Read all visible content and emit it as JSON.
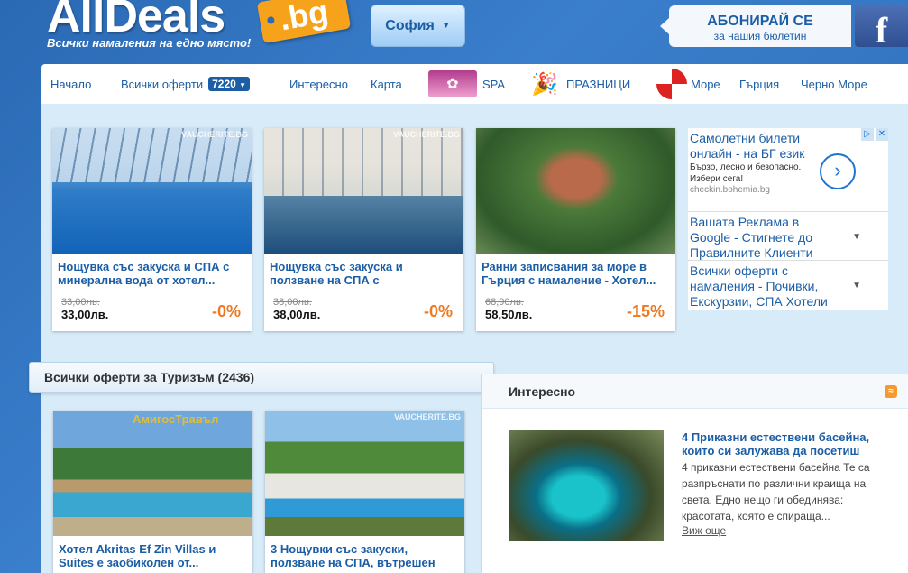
{
  "header": {
    "logo_main": "AllDeals",
    "logo_tld": ".bg",
    "slogan": "Всички намаления на едно място!",
    "city": "София",
    "subscribe_line1": "АБОНИРАЙ СЕ",
    "subscribe_line2": "за нашия бюлетин",
    "facebook": "f"
  },
  "nav": {
    "home": "Начало",
    "all_offers": "Всички оферти",
    "offers_count": "7220",
    "interesting": "Интересно",
    "map": "Карта",
    "spa": "SPA",
    "holidays": "ПРАЗНИЦИ",
    "sea": "Море",
    "greece": "Гърция",
    "black_sea": "Черно Море"
  },
  "top_deals": [
    {
      "title": "Нощувка със закуска и СПА с минерална вода от хотел...",
      "old_price": "33,00лв.",
      "new_price": "33,00лв.",
      "discount": "-0%",
      "watermark": "VAUCHERITE.BG"
    },
    {
      "title": "Нощувка със закуска и ползване на СПА с",
      "old_price": "38,00лв.",
      "new_price": "38,00лв.",
      "discount": "-0%",
      "watermark": "VAUCHERITE.BG"
    },
    {
      "title": "Ранни записвания за море в Гърция с намаление - Хотел...",
      "old_price": "68,90лв.",
      "new_price": "58,50лв.",
      "discount": "-15%",
      "watermark": ""
    }
  ],
  "ads": [
    {
      "headline": "Самолетни билети онлайн - на БГ език",
      "sub": "Бързо, лесно и безопасно. Избери сега!",
      "url": "checkin.bohemia.bg"
    },
    {
      "headline": "Вашата Реклама в Google - Стигнете до Правилните Клиенти"
    },
    {
      "headline": "Всички оферти с намаления - Почивки, Екскурзии, СПА Хотели"
    }
  ],
  "section": {
    "title": "Всички оферти за Туризъм (2436)"
  },
  "bottom_deals": [
    {
      "title": "Хотел Akritas Ef Zin Villas и Suites е заобиколен от...",
      "watermark": "АмигосТравъл"
    },
    {
      "title": "3 Нощувки със закуски, ползване на СПА, вътрешен",
      "watermark": "VAUCHERITE.BG"
    }
  ],
  "interesting": {
    "heading": "Интересно",
    "article_title": "4 Приказни естествени басейна, които си залужава да посетиш",
    "article_text": "4 приказни естествени басейна Те са разпръснати по различни краища на света. Едно нещо ги обединява: красотата, която е спираща...",
    "more": "Виж още"
  }
}
